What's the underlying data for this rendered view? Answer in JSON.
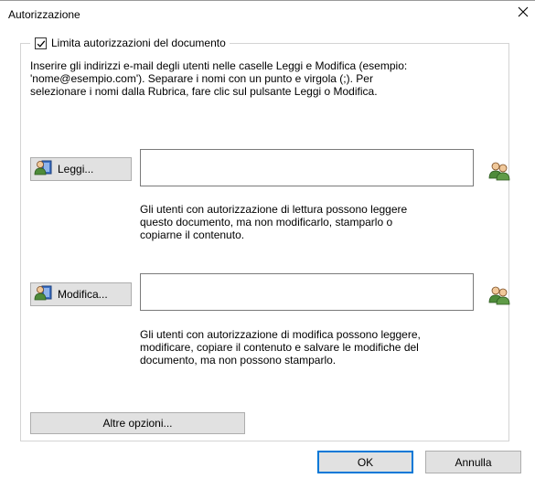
{
  "window": {
    "title": "Autorizzazione"
  },
  "restrict": {
    "checked": true,
    "label": "Limita autorizzazioni del documento"
  },
  "instructions": "Inserire gli indirizzi e-mail degli utenti nelle caselle Leggi e Modifica (esempio:\n'nome@esempio.com'). Separare i nomi con un punto e virgola (;). Per\nselezionare i nomi dalla Rubrica, fare clic sul pulsante Leggi o Modifica.",
  "read": {
    "button_label": "Leggi...",
    "input_value": "",
    "hint": "Gli utenti con autorizzazione di lettura possono leggere\nquesto documento, ma non modificarlo, stamparlo o\ncopiarne il contenuto."
  },
  "modify": {
    "button_label": "Modifica...",
    "input_value": "",
    "hint": "Gli utenti con autorizzazione di modifica possono leggere,\nmodificare, copiare il contenuto e salvare le modifiche del\ndocumento, ma non possono stamparlo."
  },
  "more_options_label": "Altre opzioni...",
  "ok_label": "OK",
  "cancel_label": "Annulla",
  "icons": {
    "close": "close-icon",
    "address_book": "address-book-icon",
    "check_names": "check-names-icon"
  },
  "colors": {
    "button_face": "#e1e1e1",
    "button_border": "#adadad",
    "default_button_border": "#0078d7",
    "group_border": "#d4d4d4"
  }
}
